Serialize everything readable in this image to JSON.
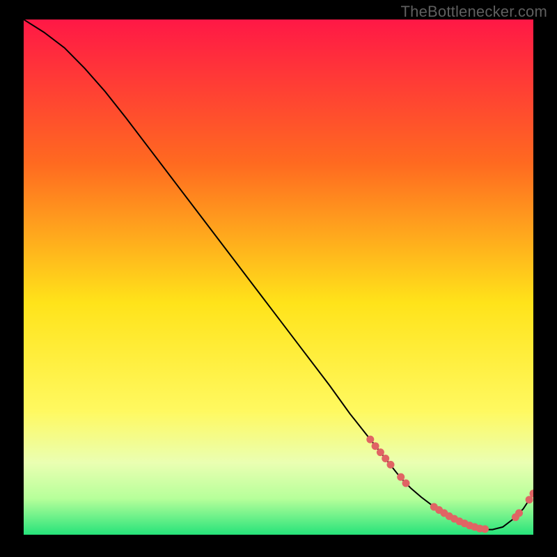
{
  "watermark": "TheBottlenecker.com",
  "colors": {
    "gradient_top": "#ff1846",
    "gradient_mid1": "#ff8a20",
    "gradient_mid2": "#ffe31a",
    "gradient_mid3": "#fff960",
    "gradient_low": "#eaffb2",
    "gradient_bottom": "#26e37a",
    "curve": "#000000",
    "marker": "#e06464"
  },
  "chart_data": {
    "type": "line",
    "title": "",
    "xlabel": "",
    "ylabel": "",
    "xlim": [
      0,
      100
    ],
    "ylim": [
      0,
      100
    ],
    "series": [
      {
        "name": "bottleneck-curve",
        "x": [
          0,
          4,
          8,
          12,
          16,
          20,
          25,
          30,
          35,
          40,
          45,
          50,
          55,
          60,
          64,
          68,
          72,
          74,
          76,
          78,
          80,
          82,
          84,
          86,
          88,
          90,
          92,
          94,
          96,
          98,
          100
        ],
        "y": [
          100,
          97.5,
          94.5,
          90.5,
          86,
          81,
          74.5,
          68,
          61.5,
          55,
          48.5,
          42,
          35.5,
          29,
          23.5,
          18.5,
          13.5,
          11,
          9,
          7.3,
          5.8,
          4.5,
          3.3,
          2.3,
          1.5,
          1,
          1,
          1.5,
          3,
          5,
          8
        ]
      }
    ],
    "markers": [
      {
        "x": 68,
        "y": 18.5
      },
      {
        "x": 69,
        "y": 17.2
      },
      {
        "x": 70,
        "y": 16
      },
      {
        "x": 71,
        "y": 14.8
      },
      {
        "x": 72,
        "y": 13.6
      },
      {
        "x": 74,
        "y": 11.2
      },
      {
        "x": 75,
        "y": 10
      },
      {
        "x": 80.5,
        "y": 5.4
      },
      {
        "x": 81.5,
        "y": 4.8
      },
      {
        "x": 82.5,
        "y": 4.2
      },
      {
        "x": 83.5,
        "y": 3.6
      },
      {
        "x": 84.5,
        "y": 3.1
      },
      {
        "x": 85.5,
        "y": 2.6
      },
      {
        "x": 86.5,
        "y": 2.2
      },
      {
        "x": 87.5,
        "y": 1.8
      },
      {
        "x": 88.5,
        "y": 1.5
      },
      {
        "x": 89.5,
        "y": 1.2
      },
      {
        "x": 90.5,
        "y": 1.1
      },
      {
        "x": 96.5,
        "y": 3.4
      },
      {
        "x": 97.2,
        "y": 4.2
      },
      {
        "x": 99.2,
        "y": 6.8
      },
      {
        "x": 100,
        "y": 8
      }
    ]
  }
}
